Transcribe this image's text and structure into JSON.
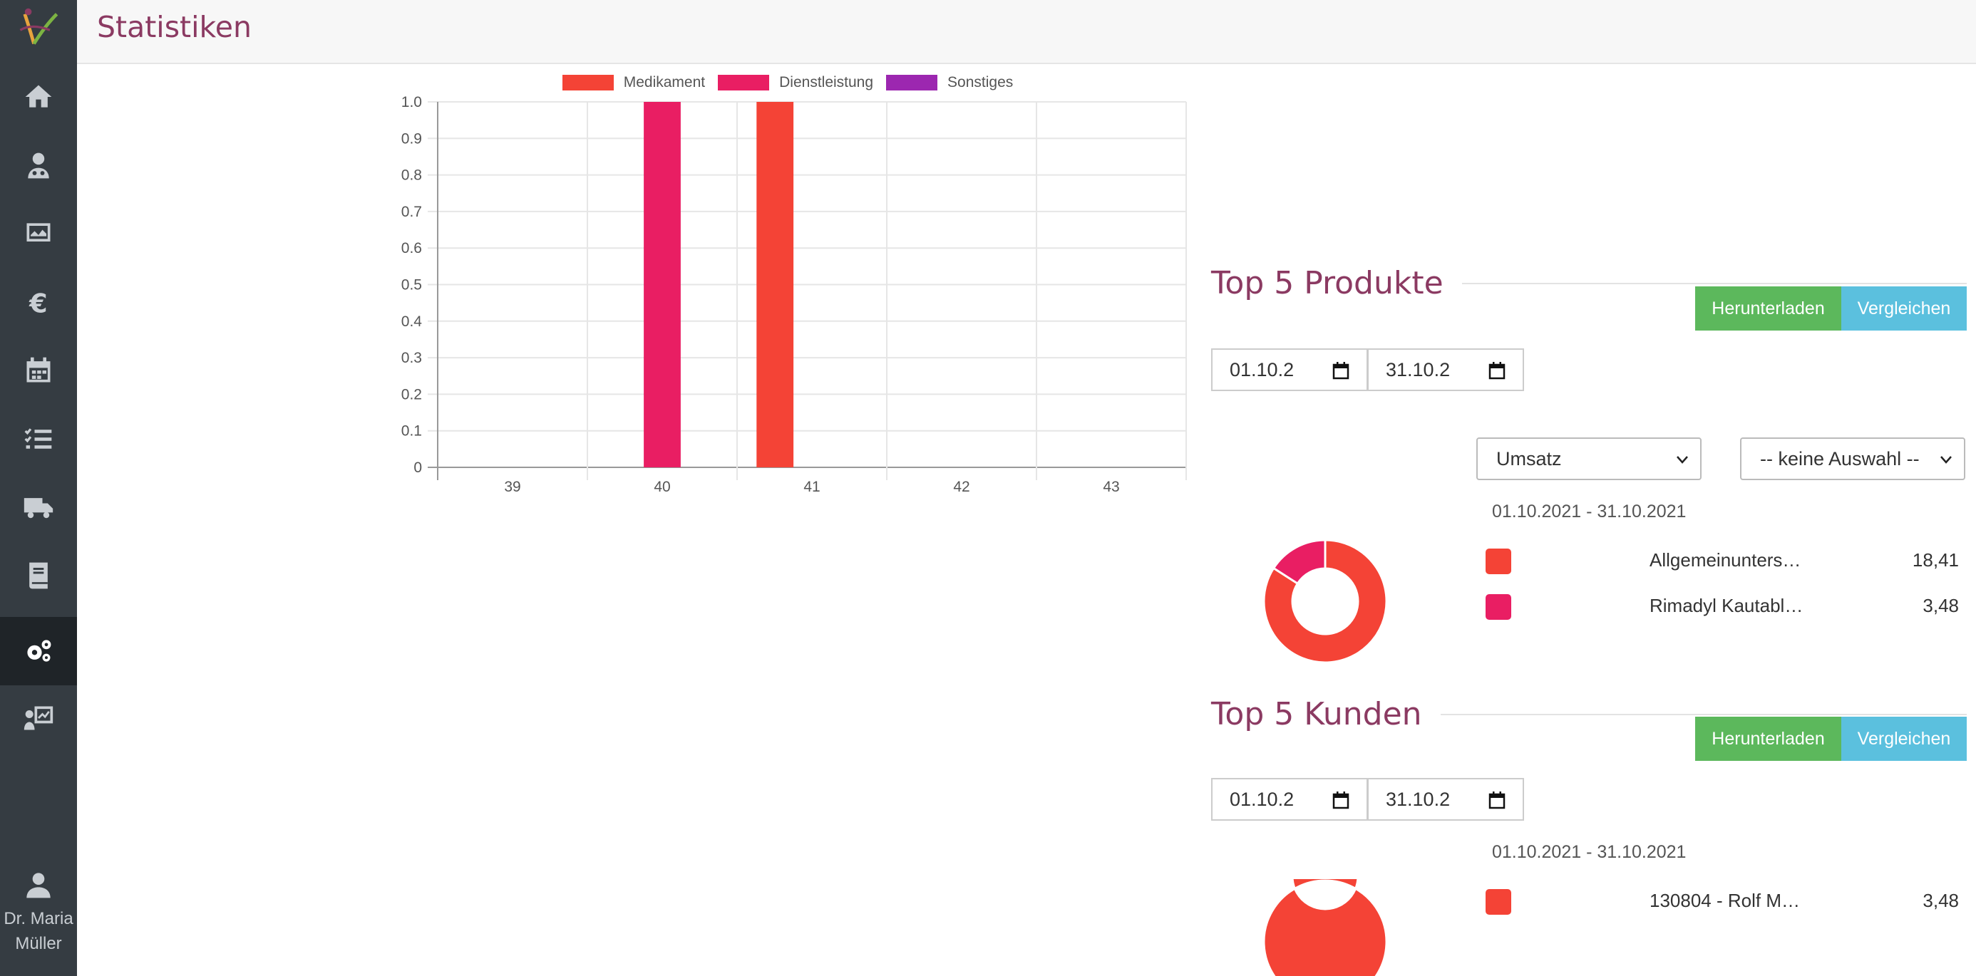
{
  "app": {
    "page_title": "Statistiken",
    "user_name_line1": "Dr. Maria",
    "user_name_line2": "Müller"
  },
  "sidebar": {
    "items": [
      {
        "icon": "home-icon"
      },
      {
        "icon": "veterinarian-icon"
      },
      {
        "icon": "monitor-chart-icon"
      },
      {
        "icon": "euro-icon"
      },
      {
        "icon": "calendar-icon"
      },
      {
        "icon": "checklist-icon"
      },
      {
        "icon": "truck-icon"
      },
      {
        "icon": "book-icon"
      },
      {
        "icon": "gears-icon",
        "active": true
      },
      {
        "icon": "presentation-chart-icon"
      }
    ],
    "user_icon": "user-icon"
  },
  "colors": {
    "brand": "#8b3a62",
    "sidebar_bg": "#353c42",
    "medikament": "#f44336",
    "dienstleistung": "#e91e63",
    "sonstiges": "#9c27b0",
    "green": "#5cb85c",
    "blue": "#5bc0de"
  },
  "chart_data": {
    "type": "bar",
    "categories": [
      "39",
      "40",
      "41",
      "42",
      "43"
    ],
    "series": [
      {
        "name": "Medikament",
        "color": "#f44336",
        "values": [
          0,
          0,
          1,
          0,
          0
        ]
      },
      {
        "name": "Dienstleistung",
        "color": "#e91e63",
        "values": [
          0,
          1,
          0,
          0,
          0
        ]
      },
      {
        "name": "Sonstiges",
        "color": "#9c27b0",
        "values": [
          0,
          0,
          0,
          0,
          0
        ]
      }
    ],
    "ylim": [
      0,
      1.0
    ],
    "yticks": [
      "0",
      "0.1",
      "0.2",
      "0.3",
      "0.4",
      "0.5",
      "0.6",
      "0.7",
      "0.8",
      "0.9",
      "1.0"
    ],
    "grid": true,
    "legend": "top"
  },
  "top_products": {
    "title": "Top 5 Produkte",
    "download_label": "Herunterladen",
    "compare_label": "Vergleichen",
    "date_from": "01.10.2",
    "date_to": "31.10.2",
    "metric_select": "Umsatz",
    "filter_select": "-- keine Auswahl --",
    "range": "01.10.2021 - 31.10.2021",
    "items": [
      {
        "label": "Allgemeinunters…",
        "value": "18,41",
        "color": "#f44336"
      },
      {
        "label": "Rimadyl Kautabl…",
        "value": "3,48",
        "color": "#e91e63"
      }
    ],
    "donut": [
      18.41,
      3.48
    ]
  },
  "top_customers": {
    "title": "Top 5 Kunden",
    "download_label": "Herunterladen",
    "compare_label": "Vergleichen",
    "date_from": "01.10.2",
    "date_to": "31.10.2",
    "range": "01.10.2021 - 31.10.2021",
    "items": [
      {
        "label": "130804 - Rolf M…",
        "value": "3,48",
        "color": "#f44336"
      }
    ],
    "donut": [
      3.48
    ]
  }
}
